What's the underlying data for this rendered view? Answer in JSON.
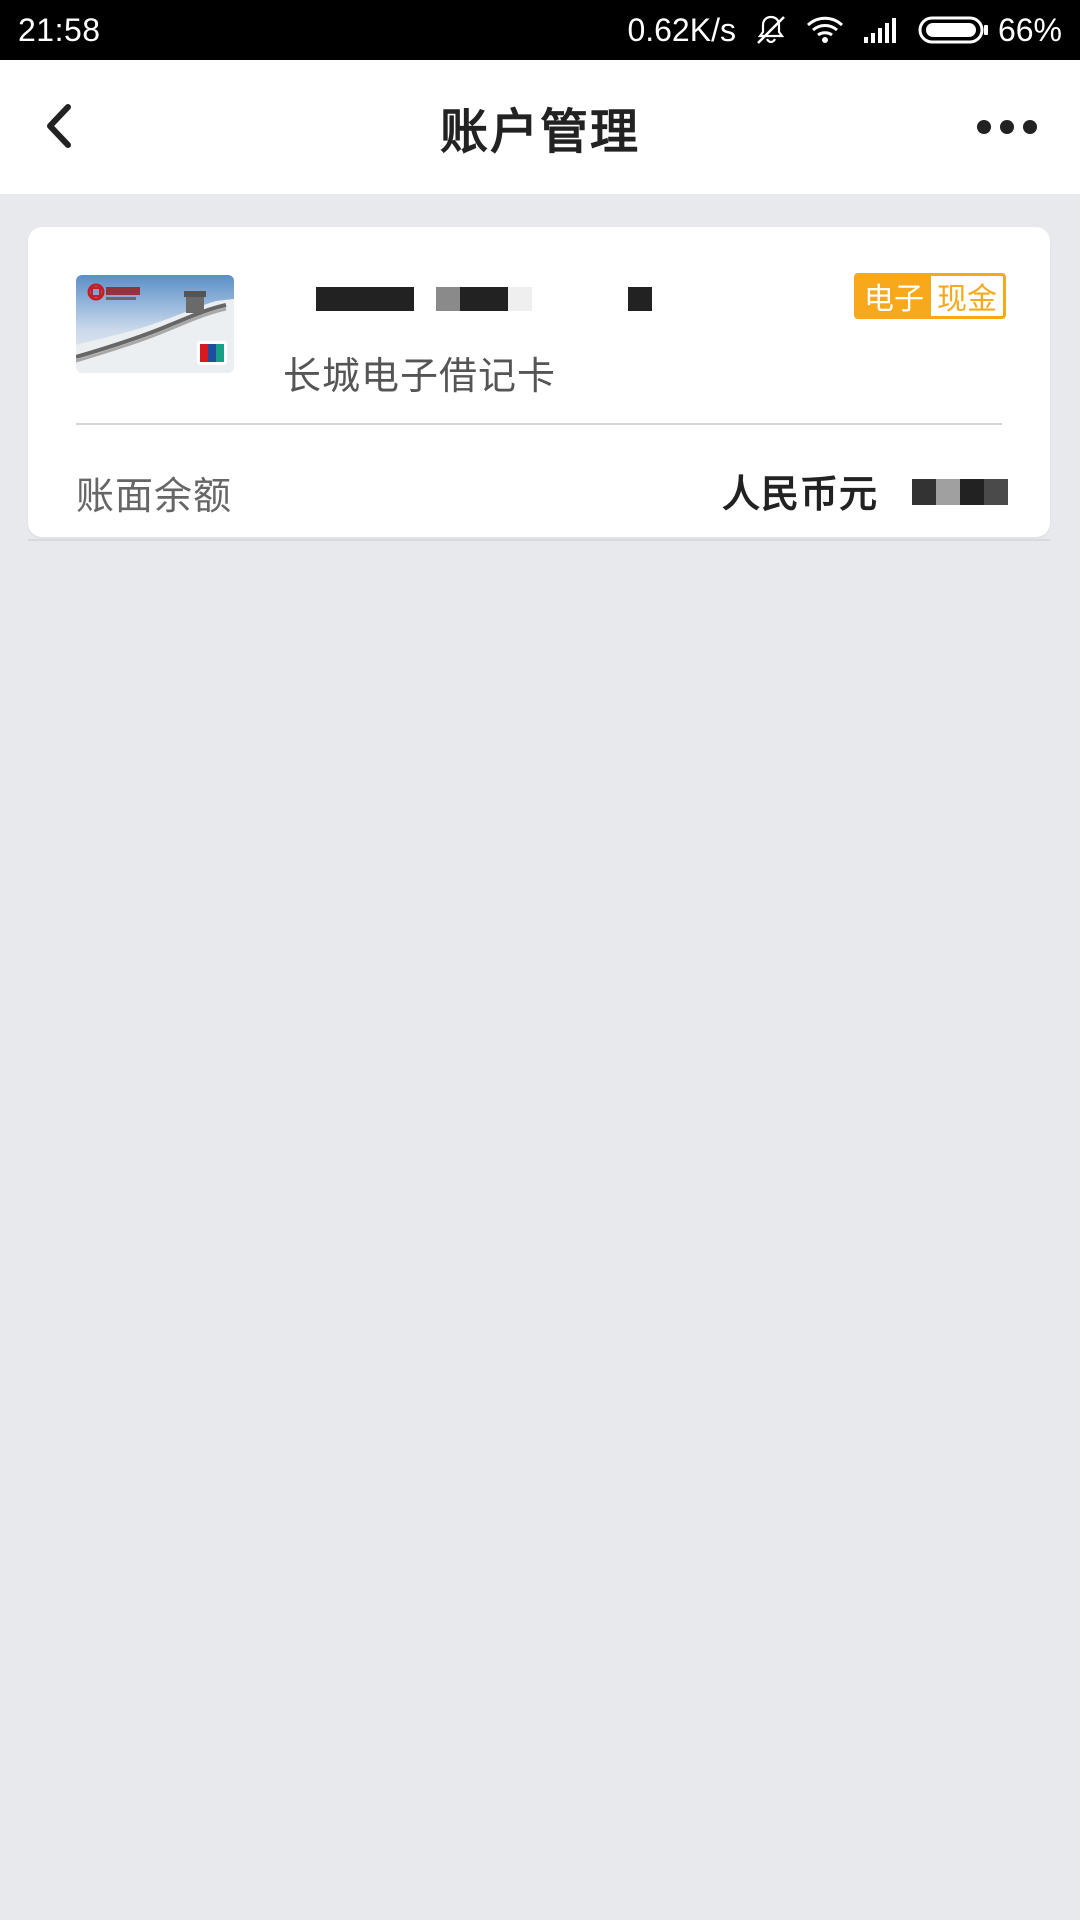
{
  "status_bar": {
    "time": "21:58",
    "network_speed": "0.62K/s",
    "battery_percent": "66%",
    "icons": [
      "bell-off-icon",
      "wifi-icon",
      "signal-icon",
      "battery-icon"
    ]
  },
  "nav": {
    "title": "账户管理",
    "back_icon": "chevron-left-icon",
    "more_icon": "more-horizontal-icon"
  },
  "account_card": {
    "card_image": "card-thumbnail-image",
    "card_name": "长城电子借记卡",
    "badge": {
      "left": "电子",
      "right": "现金",
      "color": "#f7a91b"
    },
    "balance_label": "账面余额",
    "currency": "人民币元"
  },
  "colors": {
    "background": "#e8e9ed",
    "card": "#ffffff",
    "accent": "#f7a91b",
    "status_bar": "#000000"
  }
}
